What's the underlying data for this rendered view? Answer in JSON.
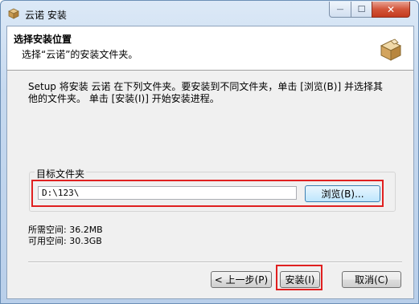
{
  "window": {
    "title": "云诺 安装",
    "close_glyph": "✕",
    "minimize_glyph": "—",
    "maximize_glyph": "☐"
  },
  "header": {
    "title": "选择安装位置",
    "subtitle": "选择“云诺”的安装文件夹。",
    "icon": "package-box-icon"
  },
  "intro": "Setup 将安装 云诺 在下列文件夹。要安装到不同文件夹，单击 [浏览(B)] 并选择其他的文件夹。 单击 [安装(I)] 开始安装进程。",
  "target_folder": {
    "label": "目标文件夹",
    "value": "D:\\123\\",
    "browse_label": "浏览(B)..."
  },
  "space": {
    "required": "所需空间: 36.2MB",
    "available": "可用空间: 30.3GB"
  },
  "buttons": {
    "back": "< 上一步(P)",
    "install": "安装(I)",
    "cancel": "取消(C)"
  },
  "colors": {
    "highlight": "#e02020",
    "title_bar": "#c6d9ef"
  }
}
